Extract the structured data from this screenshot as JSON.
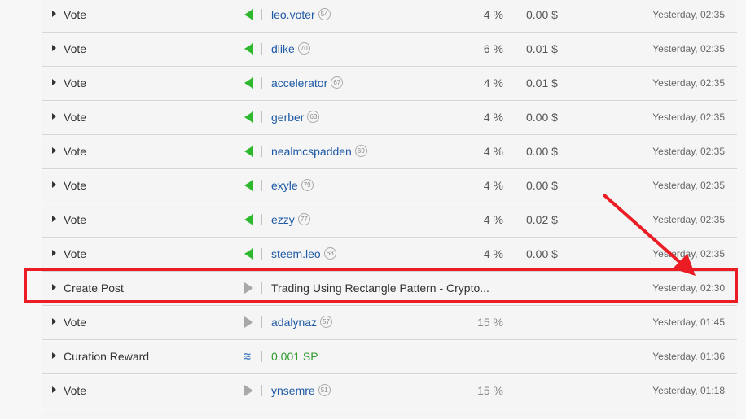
{
  "rows": [
    {
      "type": "Vote",
      "direction": "up",
      "user": "leo.voter",
      "rep": "54",
      "pct": "4 %",
      "usd": "0.00 $",
      "time": "Yesterday, 02:35"
    },
    {
      "type": "Vote",
      "direction": "up",
      "user": "dlike",
      "rep": "70",
      "pct": "6 %",
      "usd": "0.01 $",
      "time": "Yesterday, 02:35"
    },
    {
      "type": "Vote",
      "direction": "up",
      "user": "accelerator",
      "rep": "67",
      "pct": "4 %",
      "usd": "0.01 $",
      "time": "Yesterday, 02:35"
    },
    {
      "type": "Vote",
      "direction": "up",
      "user": "gerber",
      "rep": "63",
      "pct": "4 %",
      "usd": "0.00 $",
      "time": "Yesterday, 02:35"
    },
    {
      "type": "Vote",
      "direction": "up",
      "user": "nealmcspadden",
      "rep": "69",
      "pct": "4 %",
      "usd": "0.00 $",
      "time": "Yesterday, 02:35"
    },
    {
      "type": "Vote",
      "direction": "up",
      "user": "exyle",
      "rep": "79",
      "pct": "4 %",
      "usd": "0.00 $",
      "time": "Yesterday, 02:35"
    },
    {
      "type": "Vote",
      "direction": "up",
      "user": "ezzy",
      "rep": "77",
      "pct": "4 %",
      "usd": "0.02 $",
      "time": "Yesterday, 02:35"
    },
    {
      "type": "Vote",
      "direction": "up",
      "user": "steem.leo",
      "rep": "68",
      "pct": "4 %",
      "usd": "0.00 $",
      "time": "Yesterday, 02:35"
    },
    {
      "type": "Create Post",
      "direction": "out",
      "title": "Trading Using Rectangle Pattern - Crypto...",
      "time": "Yesterday, 02:30"
    },
    {
      "type": "Vote",
      "direction": "out",
      "user": "adalynaz",
      "rep": "57",
      "pct": "15 %",
      "time": "Yesterday, 01:45"
    },
    {
      "type": "Curation Reward",
      "direction": "steem",
      "amount": "0.001 SP",
      "time": "Yesterday, 01:36"
    },
    {
      "type": "Vote",
      "direction": "out",
      "user": "ynsemre",
      "rep": "51",
      "pct": "15 %",
      "time": "Yesterday, 01:18"
    }
  ],
  "colors": {
    "upvote": "#2db82d",
    "outgoing": "#a8a8a8",
    "link": "#1f5aa6",
    "highlight": "#ec1c24"
  }
}
